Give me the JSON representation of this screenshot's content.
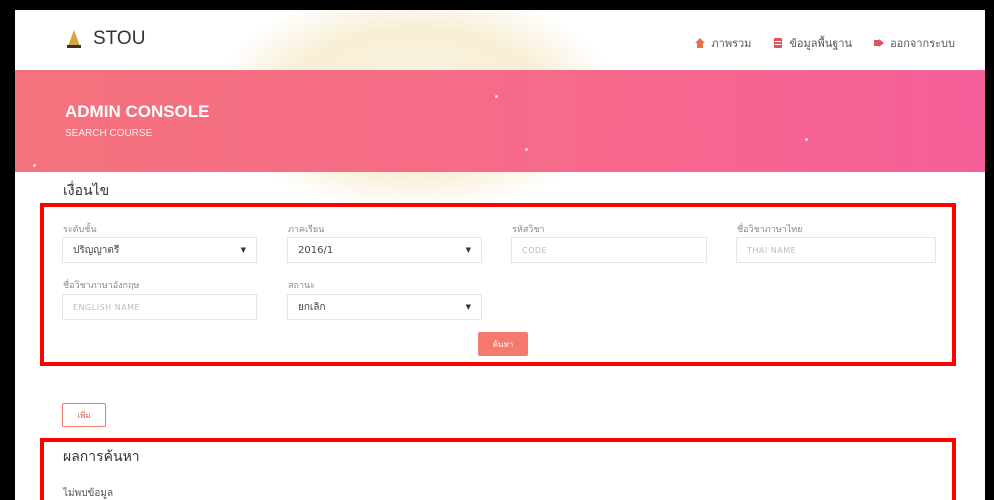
{
  "nav": {
    "brand": "STOU",
    "links": [
      {
        "label": "ภาพรวม",
        "icon": "home-icon",
        "color": "#e8734a"
      },
      {
        "label": "ข้อมูลพื้นฐาน",
        "icon": "database-icon",
        "color": "#e05260"
      },
      {
        "label": "ออกจากระบบ",
        "icon": "logout-icon",
        "color": "#e05260"
      }
    ]
  },
  "hero": {
    "title": "ADMIN CONSOLE",
    "subtitle": "SEARCH COURSE"
  },
  "conditions": {
    "title": "เงื่อนไข",
    "level_label": "ระดับชั้น",
    "level_value": "ปริญญาตรี",
    "term_label": "ภาคเรียน",
    "term_value": "2016/1",
    "code_label": "รหัสวิชา",
    "code_placeholder": "CODE",
    "thai_name_label": "ชื่อวิชาภาษาไทย",
    "thai_name_placeholder": "THAI NAME",
    "english_name_label": "ชื่อวิชาภาษาอังกฤษ",
    "english_name_placeholder": "ENGLISH NAME",
    "status_label": "สถานะ",
    "status_value": "ยกเลิก",
    "search_button": "ค้นหา"
  },
  "actions": {
    "add_button": "เพิ่ม"
  },
  "results": {
    "title": "ผลการค้นหา",
    "empty_text": "ไม่พบข้อมูล"
  },
  "colors": {
    "hero_gradient_start": "#f4727c",
    "hero_gradient_end": "#f55f9a",
    "accent": "#f47a6e",
    "highlight_box": "#ff0000"
  }
}
